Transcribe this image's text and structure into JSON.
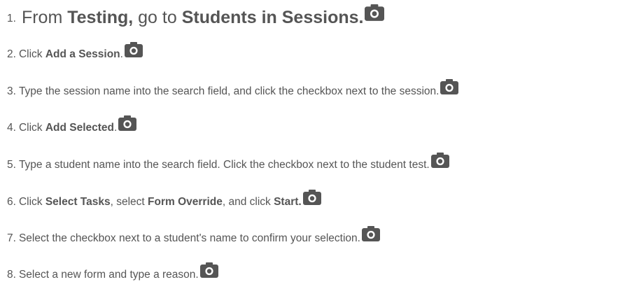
{
  "steps": [
    {
      "number": "1.",
      "parts": [
        {
          "text": "From ",
          "bold": false
        },
        {
          "text": "Testing,",
          "bold": true
        },
        {
          "text": " go to ",
          "bold": false
        },
        {
          "text": "Students in Sessions.",
          "bold": true
        }
      ],
      "icon": "camera-icon"
    },
    {
      "number": "2.",
      "parts": [
        {
          "text": "Click ",
          "bold": false
        },
        {
          "text": "Add a Session",
          "bold": true
        },
        {
          "text": ".",
          "bold": false
        }
      ],
      "icon": "camera-icon"
    },
    {
      "number": "3.",
      "parts": [
        {
          "text": "Type the session name into the search field, and click the checkbox next to the session.",
          "bold": false
        }
      ],
      "icon": "camera-icon"
    },
    {
      "number": "4.",
      "parts": [
        {
          "text": "Click ",
          "bold": false
        },
        {
          "text": "Add Selected",
          "bold": true
        },
        {
          "text": ".",
          "bold": false
        }
      ],
      "icon": "camera-icon"
    },
    {
      "number": "5.",
      "parts": [
        {
          "text": "Type a student name into the search field. Click the checkbox next to the student test.",
          "bold": false
        }
      ],
      "icon": "camera-icon"
    },
    {
      "number": "6.",
      "parts": [
        {
          "text": "Click ",
          "bold": false
        },
        {
          "text": "Select Tasks",
          "bold": true
        },
        {
          "text": ", select ",
          "bold": false
        },
        {
          "text": "Form Override",
          "bold": true
        },
        {
          "text": ", and click ",
          "bold": false
        },
        {
          "text": "Start.",
          "bold": true
        }
      ],
      "icon": "camera-icon"
    },
    {
      "number": "7.",
      "parts": [
        {
          "text": "Select the checkbox next to a student's name to confirm your selection.",
          "bold": false
        }
      ],
      "icon": "camera-icon"
    },
    {
      "number": "8.",
      "parts": [
        {
          "text": "Select a new form and type a reason.",
          "bold": false
        }
      ],
      "icon": "camera-icon"
    }
  ],
  "colors": {
    "text": "#555555",
    "icon": "#555555"
  }
}
